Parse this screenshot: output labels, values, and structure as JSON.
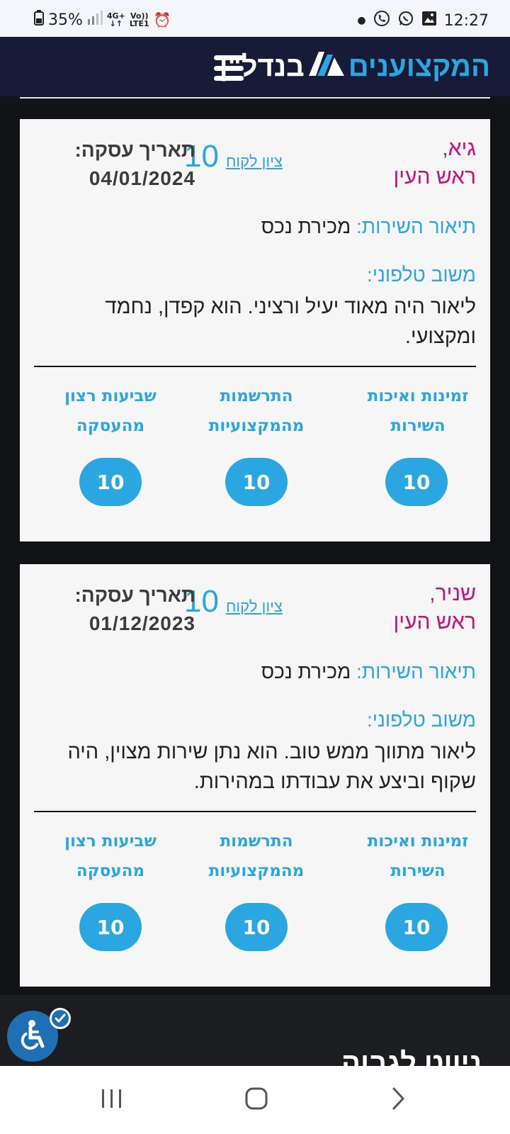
{
  "status_bar": {
    "battery": "35%",
    "network_top": "4G+",
    "network_volte": "Vo))",
    "network_lte": "LTE1",
    "time": "12:27"
  },
  "header": {
    "logo_part1": "המקצוענים",
    "logo_part2": "בנדל\"ן",
    "menu_icon": "hamburger-icon"
  },
  "reviews": [
    {
      "reviewer_name": "גיא,",
      "reviewer_city": "ראש העין",
      "customer_score_link": "ציון לקוח",
      "customer_score": "10",
      "date_label": "תאריך עסקה:",
      "date_value": "04/01/2024",
      "service_label": "תיאור השירות:",
      "service_value": "מכירת נכס",
      "feedback_label": "משוב טלפוני:",
      "feedback_text": "ליאור היה מאוד יעיל ורציני. הוא קפדן, נחמד ומקצועי.",
      "metrics": [
        {
          "label": "זמינות ואיכות השירות",
          "value": "10"
        },
        {
          "label": "התרשמות מהמקצועיות",
          "value": "10"
        },
        {
          "label": "שביעות רצון מהעסקה",
          "value": "10"
        }
      ]
    },
    {
      "reviewer_name": "שניר,",
      "reviewer_city": "ראש העין",
      "customer_score_link": "ציון לקוח",
      "customer_score": "10",
      "date_label": "תאריך עסקה:",
      "date_value": "01/12/2023",
      "service_label": "תיאור השירות:",
      "service_value": "מכירת נכס",
      "feedback_label": "משוב טלפוני:",
      "feedback_text": "ליאור מתווך ממש טוב. הוא נתן שירות מצוין, היה שקוף וביצע את עבודתו במהירות.",
      "metrics": [
        {
          "label": "זמינות ואיכות השירות",
          "value": "10"
        },
        {
          "label": "התרשמות מהמקצועיות",
          "value": "10"
        },
        {
          "label": "שביעות רצון מהעסקה",
          "value": "10"
        }
      ]
    }
  ],
  "footer": {
    "partial_title": "ניווט לגבוה"
  },
  "accessibility": {
    "icon": "wheelchair-icon",
    "badge_icon": "check-icon"
  },
  "nav_bar": {
    "recents_icon": "recents-icon",
    "home_icon": "home-icon",
    "back_icon": "back-icon"
  },
  "colors": {
    "accent": "#2aa7e0",
    "name": "#c4127a",
    "header_bg": "#181b37",
    "page_bg": "#121316"
  }
}
